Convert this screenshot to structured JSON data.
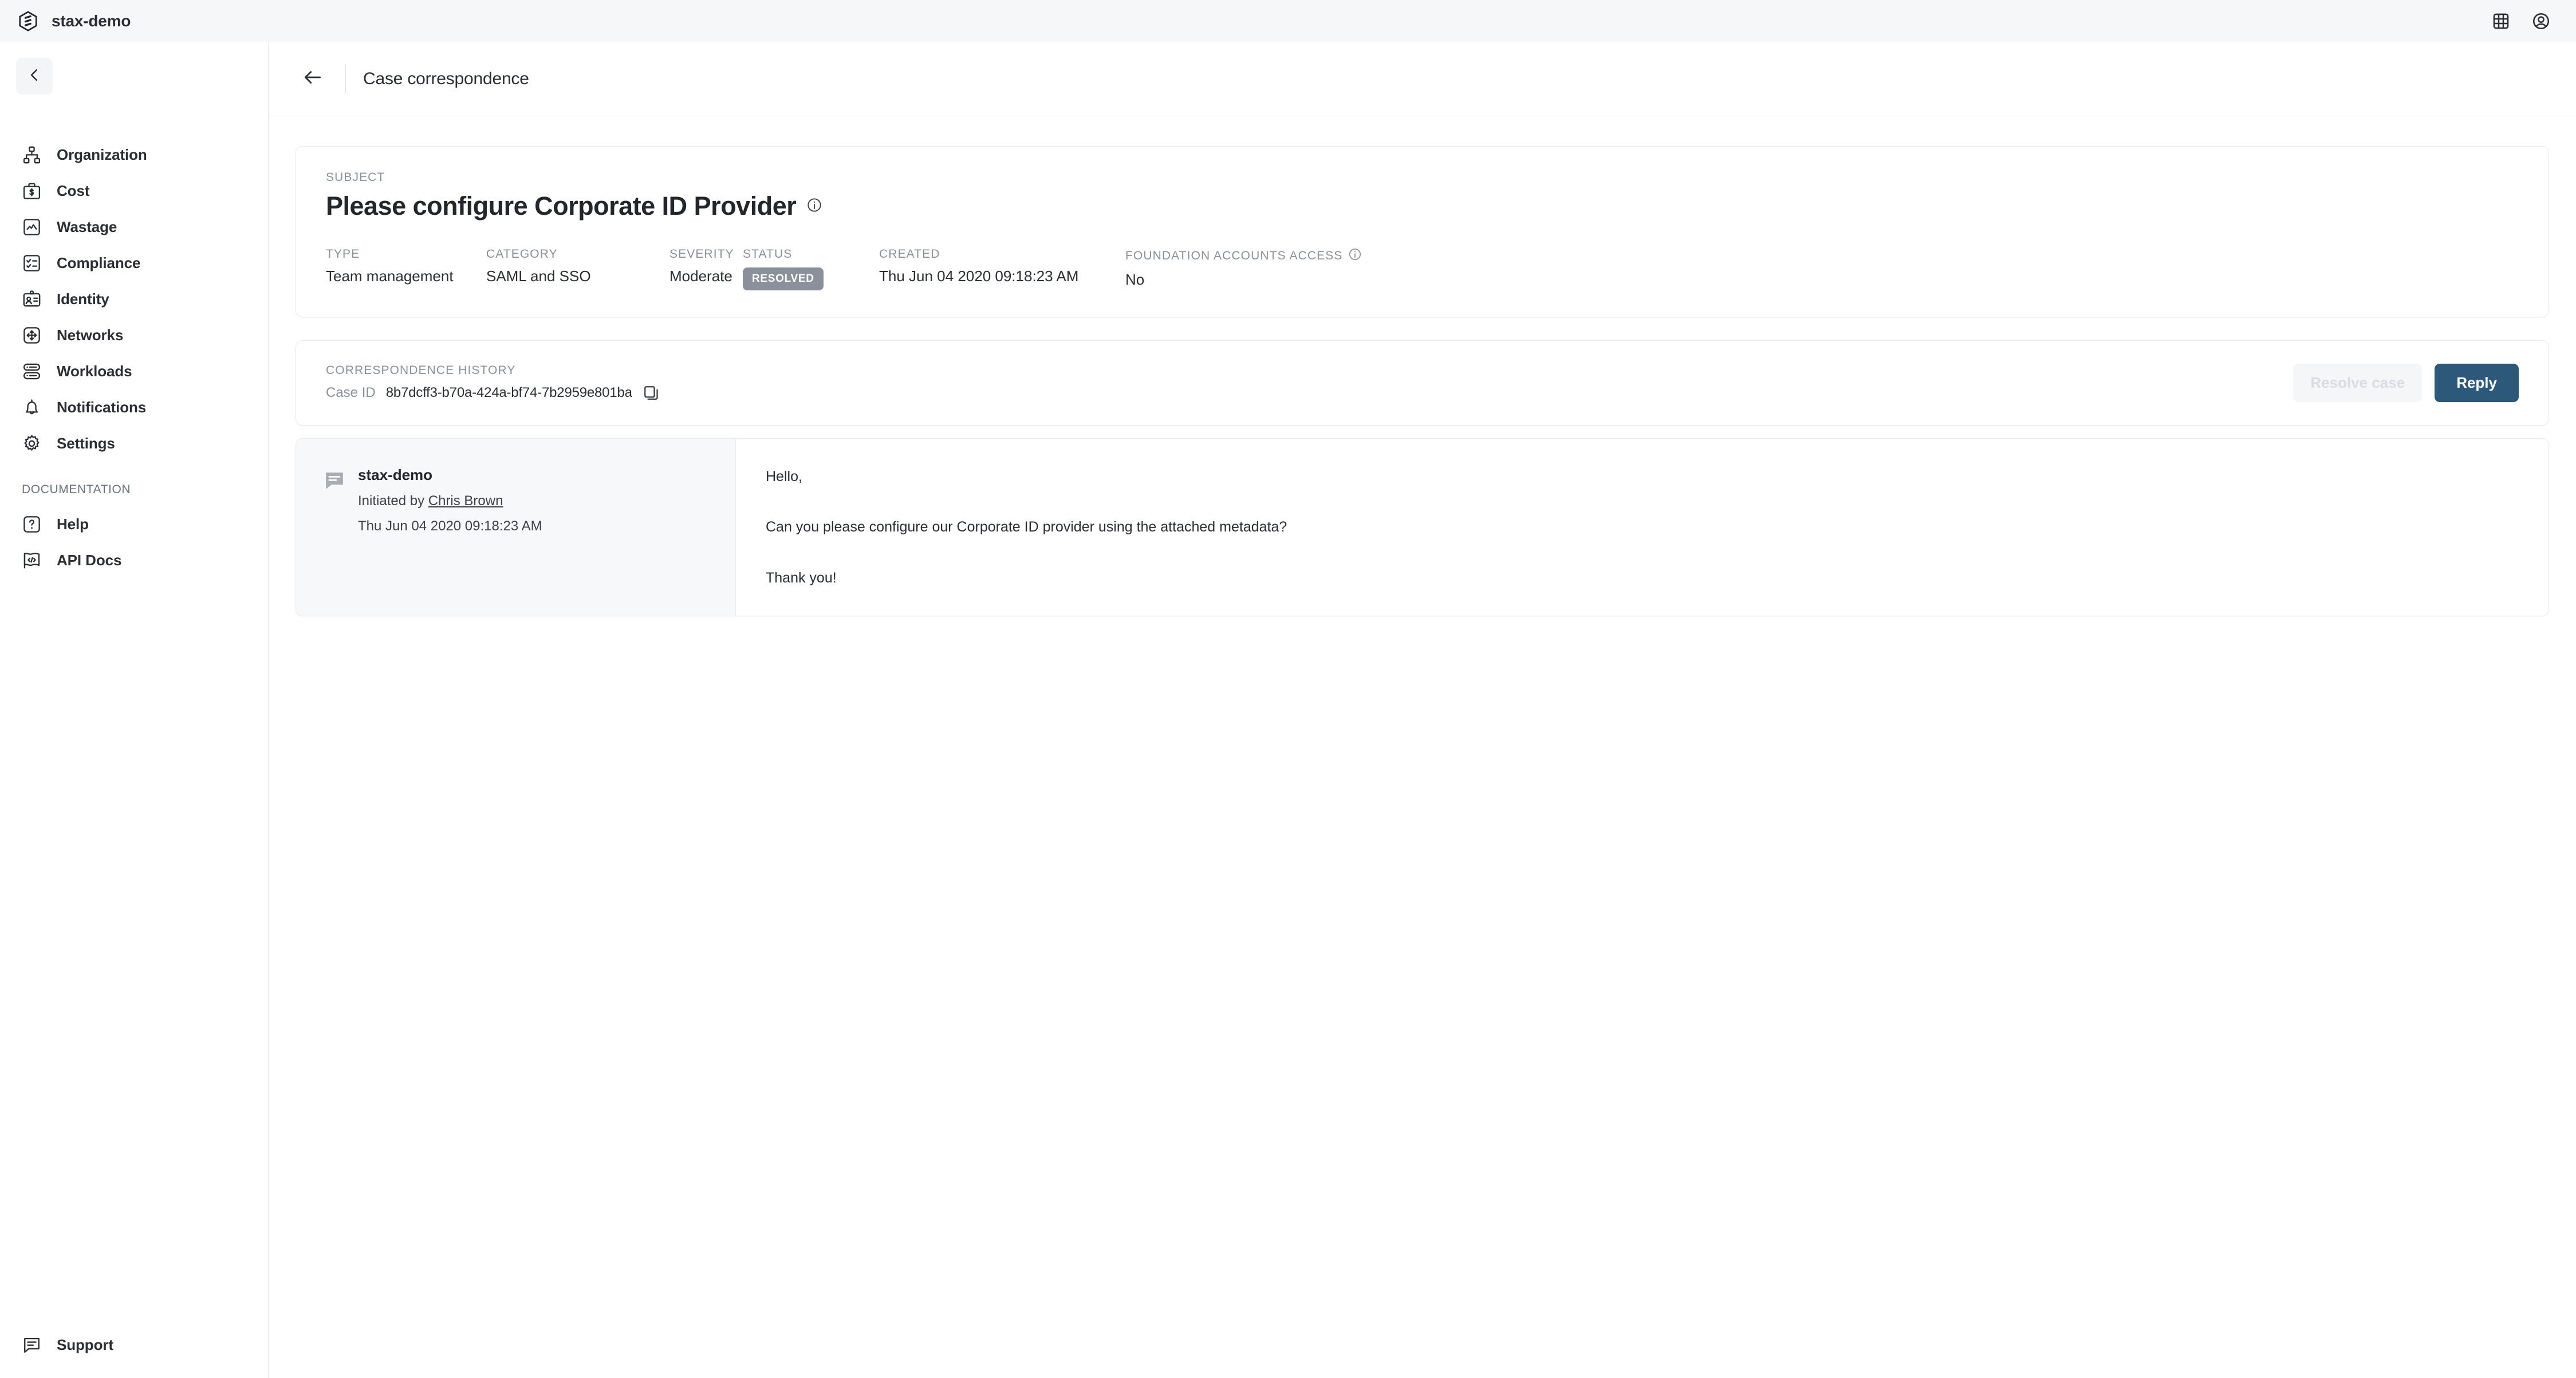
{
  "topbar": {
    "brand": "stax-demo",
    "icons": [
      {
        "name": "apps-grid-icon"
      },
      {
        "name": "account-circle-icon"
      }
    ]
  },
  "sidebar": {
    "collapse_label": "Collapse navigation",
    "items": [
      {
        "label": "Organization",
        "icon": "org-chart-icon"
      },
      {
        "label": "Cost",
        "icon": "briefcase-dollar-icon"
      },
      {
        "label": "Wastage",
        "icon": "chart-box-icon"
      },
      {
        "label": "Compliance",
        "icon": "checklist-icon"
      },
      {
        "label": "Identity",
        "icon": "id-badge-icon"
      },
      {
        "label": "Networks",
        "icon": "move-arrows-icon"
      },
      {
        "label": "Workloads",
        "icon": "server-stack-icon"
      },
      {
        "label": "Notifications",
        "icon": "bell-icon"
      },
      {
        "label": "Settings",
        "icon": "gear-icon"
      }
    ],
    "section_title": "DOCUMENTATION",
    "doc_items": [
      {
        "label": "Help",
        "icon": "question-box-icon"
      },
      {
        "label": "API Docs",
        "icon": "code-flag-icon"
      }
    ],
    "footer_items": [
      {
        "label": "Support",
        "icon": "speech-bubble-icon"
      }
    ]
  },
  "header": {
    "back_label": "Back",
    "title": "Case correspondence"
  },
  "case": {
    "subject_label": "SUBJECT",
    "subject": "Please configure Corporate ID Provider",
    "subject_info_icon": "info-icon",
    "fields": [
      {
        "label": "TYPE",
        "value": "Team management"
      },
      {
        "label": "CATEGORY",
        "value": "SAML and SSO"
      },
      {
        "label": "SEVERITY",
        "value": "Moderate"
      },
      {
        "label": "STATUS",
        "value": "RESOLVED"
      },
      {
        "label": "CREATED",
        "value": "Thu Jun 04 2020 09:18:23 AM"
      },
      {
        "label": "FOUNDATION ACCOUNTS ACCESS",
        "value": "No"
      }
    ],
    "status_badge_color": "#8b919b"
  },
  "history": {
    "title": "CORRESPONDENCE HISTORY",
    "case_id_label": "Case ID",
    "case_id": "8b7dcff3-b70a-424a-bf74-7b2959e801ba",
    "copy_icon": "copy-icon",
    "resolve_label": "Resolve case",
    "reply_label": "Reply",
    "reply_color": "#2c587a"
  },
  "messages": [
    {
      "author": "stax-demo",
      "initiated_prefix": "Initiated by ",
      "initiated_by": "Chris Brown",
      "date": "Thu Jun 04 2020 09:18:23 AM",
      "body": [
        "Hello,",
        "Can you please configure our Corporate ID provider using the attached metadata?",
        "Thank you!"
      ]
    }
  ]
}
